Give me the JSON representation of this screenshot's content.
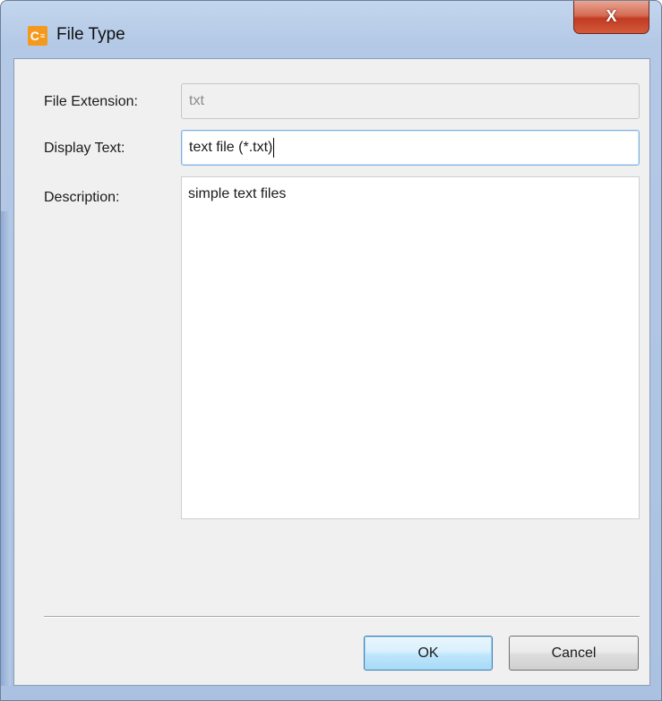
{
  "window": {
    "title": "File Type",
    "app_icon_text": "C",
    "app_icon_sub": "≡",
    "close_glyph": "X"
  },
  "form": {
    "extension_label": "File Extension:",
    "extension_value": "txt",
    "display_label": "Display Text:",
    "display_value": "text file (*.txt)",
    "description_label": "Description:",
    "description_value": "simple text files"
  },
  "buttons": {
    "ok_label": "OK",
    "cancel_label": "Cancel"
  },
  "colors": {
    "close_button": "#c13b22",
    "ok_button_border": "#3c7fb1",
    "app_icon": "#f39a1e"
  },
  "icons": {
    "app": "app-logo-icon",
    "close": "close-icon"
  }
}
